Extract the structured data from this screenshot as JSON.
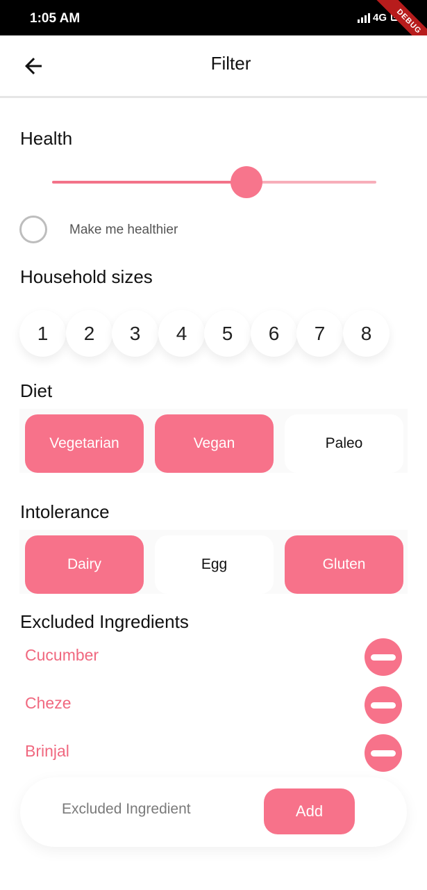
{
  "status_bar": {
    "time": "1:05 AM",
    "network": "4G",
    "debug_label": "DEBUG"
  },
  "app_bar": {
    "title": "Filter",
    "back_icon": "arrow-left-icon"
  },
  "health": {
    "title": "Health",
    "slider_value_fraction": 0.6,
    "healthier_toggle": {
      "label": "Make me healthier",
      "checked": false
    }
  },
  "household": {
    "title": "Household sizes",
    "options": [
      "1",
      "2",
      "3",
      "4",
      "5",
      "6",
      "7",
      "8"
    ]
  },
  "diet": {
    "title": "Diet",
    "options": [
      {
        "label": "Vegetarian",
        "selected": true
      },
      {
        "label": "Vegan",
        "selected": true
      },
      {
        "label": "Paleo",
        "selected": false
      }
    ]
  },
  "intolerance": {
    "title": "Intolerance",
    "options": [
      {
        "label": "Dairy",
        "selected": true
      },
      {
        "label": "Egg",
        "selected": false
      },
      {
        "label": "Gluten",
        "selected": true
      }
    ]
  },
  "excluded": {
    "title": "Excluded Ingredients",
    "items": [
      {
        "name": "Cucumber"
      },
      {
        "name": "Cheze"
      },
      {
        "name": "Brinjal"
      }
    ],
    "input_placeholder": "Excluded Ingredient",
    "add_label": "Add"
  },
  "colors": {
    "accent": "#f7728a",
    "accent_text": "#f0687f",
    "track_inactive": "#f7aeb9"
  }
}
